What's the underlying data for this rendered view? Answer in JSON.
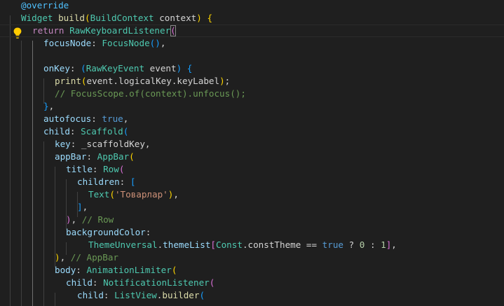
{
  "editor": {
    "theme_colors": {
      "background": "#1f1f1f",
      "keyword": "#569cd6",
      "control": "#c586c0",
      "type": "#4ec9b0",
      "function": "#dcdcaa",
      "variable": "#9cdcfe",
      "string": "#ce9178",
      "number": "#b5cea8",
      "comment": "#6a9955",
      "bracket1": "#ffd700",
      "bracket2": "#da70d6",
      "bracket3": "#179fff"
    },
    "gutter_icon": "lightbulb-icon",
    "lines": [
      [
        [
          "ann",
          "@override"
        ]
      ],
      [
        [
          "ty",
          "Widget"
        ],
        [
          "pl",
          " "
        ],
        [
          "fn",
          "build"
        ],
        [
          "b1",
          "("
        ],
        [
          "ty",
          "BuildContext"
        ],
        [
          "pl",
          " context"
        ],
        [
          "b1",
          ")"
        ],
        [
          "pl",
          " "
        ],
        [
          "b1",
          "{"
        ]
      ],
      [
        [
          "ctl",
          "return"
        ],
        [
          "pl",
          " "
        ],
        [
          "ty",
          "RawKeyboardListener"
        ],
        [
          "b2",
          "("
        ]
      ],
      [
        [
          "var",
          "focusNode"
        ],
        [
          "pl",
          ": "
        ],
        [
          "ty",
          "FocusNode"
        ],
        [
          "b3",
          "()"
        ],
        [
          "pl",
          ","
        ]
      ],
      [],
      [
        [
          "var",
          "onKey"
        ],
        [
          "pl",
          ": "
        ],
        [
          "b3",
          "("
        ],
        [
          "ty",
          "RawKeyEvent"
        ],
        [
          "pl",
          " event"
        ],
        [
          "b3",
          ")"
        ],
        [
          "pl",
          " "
        ],
        [
          "b3",
          "{"
        ]
      ],
      [
        [
          "fn",
          "print"
        ],
        [
          "b1",
          "("
        ],
        [
          "pl",
          "event.logicalKey.keyLabel"
        ],
        [
          "b1",
          ")"
        ],
        [
          "pl",
          ";"
        ]
      ],
      [
        [
          "cmt",
          "// FocusScope.of(context).unfocus();"
        ]
      ],
      [
        [
          "b3",
          "}"
        ],
        [
          "pl",
          ","
        ]
      ],
      [
        [
          "var",
          "autofocus"
        ],
        [
          "pl",
          ": "
        ],
        [
          "kw",
          "true"
        ],
        [
          "pl",
          ","
        ]
      ],
      [
        [
          "var",
          "child"
        ],
        [
          "pl",
          ": "
        ],
        [
          "ty",
          "Scaffold"
        ],
        [
          "b3",
          "("
        ]
      ],
      [
        [
          "var",
          "key"
        ],
        [
          "pl",
          ": _scaffoldKey,"
        ]
      ],
      [
        [
          "var",
          "appBar"
        ],
        [
          "pl",
          ": "
        ],
        [
          "ty",
          "AppBar"
        ],
        [
          "b1",
          "("
        ]
      ],
      [
        [
          "var",
          "title"
        ],
        [
          "pl",
          ": "
        ],
        [
          "ty",
          "Row"
        ],
        [
          "b2",
          "("
        ]
      ],
      [
        [
          "var",
          "children"
        ],
        [
          "pl",
          ": "
        ],
        [
          "b3",
          "["
        ]
      ],
      [
        [
          "ty",
          "Text"
        ],
        [
          "b1",
          "("
        ],
        [
          "str",
          "'Товарлар'"
        ],
        [
          "b1",
          ")"
        ],
        [
          "pl",
          ","
        ]
      ],
      [
        [
          "b3",
          "]"
        ],
        [
          "pl",
          ","
        ]
      ],
      [
        [
          "b2",
          ")"
        ],
        [
          "pl",
          ", "
        ],
        [
          "cmt",
          "// Row"
        ]
      ],
      [
        [
          "var",
          "backgroundColor"
        ],
        [
          "pl",
          ":"
        ]
      ],
      [
        [
          "ty",
          "ThemeUnversal"
        ],
        [
          "pl",
          "."
        ],
        [
          "var",
          "themeList"
        ],
        [
          "b2",
          "["
        ],
        [
          "ty",
          "Const"
        ],
        [
          "pl",
          ".constTheme == "
        ],
        [
          "kw",
          "true"
        ],
        [
          "pl",
          " ? "
        ],
        [
          "num",
          "0"
        ],
        [
          "pl",
          " : "
        ],
        [
          "num",
          "1"
        ],
        [
          "b2",
          "]"
        ],
        [
          "pl",
          ","
        ]
      ],
      [
        [
          "b1",
          ")"
        ],
        [
          "pl",
          ", "
        ],
        [
          "cmt",
          "// AppBar"
        ]
      ],
      [
        [
          "var",
          "body"
        ],
        [
          "pl",
          ": "
        ],
        [
          "ty",
          "AnimationLimiter"
        ],
        [
          "b1",
          "("
        ]
      ],
      [
        [
          "var",
          "child"
        ],
        [
          "pl",
          ": "
        ],
        [
          "ty",
          "NotificationListener"
        ],
        [
          "b2",
          "("
        ]
      ],
      [
        [
          "var",
          "child"
        ],
        [
          "pl",
          ": "
        ],
        [
          "ty",
          "ListView"
        ],
        [
          "pl",
          "."
        ],
        [
          "fn",
          "builder"
        ],
        [
          "b3",
          "("
        ]
      ]
    ]
  }
}
